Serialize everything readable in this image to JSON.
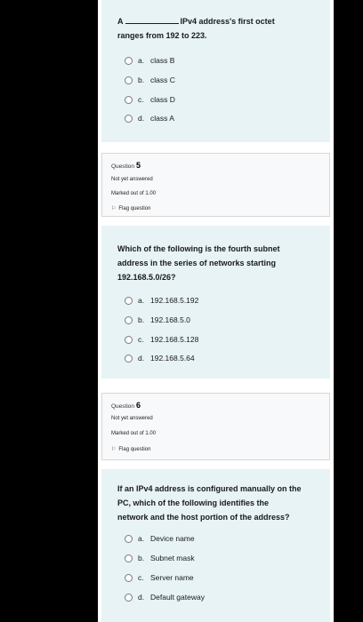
{
  "q4": {
    "prefix": "A",
    "suffix": "IPv4 address's first octet",
    "line2": "ranges from 192 to 223.",
    "options": [
      {
        "letter": "a.",
        "text": "class B"
      },
      {
        "letter": "b.",
        "text": "class C"
      },
      {
        "letter": "c.",
        "text": "class D"
      },
      {
        "letter": "d.",
        "text": "class A"
      }
    ]
  },
  "q5_info": {
    "label": "Question",
    "number": "5",
    "status": "Not yet answered",
    "marks": "Marked out of 1.00",
    "flag": "Flag question"
  },
  "q5": {
    "lines": [
      "Which of the following is the fourth subnet",
      "address in the series of networks starting",
      "192.168.5.0/26?"
    ],
    "options": [
      {
        "letter": "a.",
        "text": "192.168.5.192"
      },
      {
        "letter": "b.",
        "text": "192.168.5.0"
      },
      {
        "letter": "c.",
        "text": "192.168.5.128"
      },
      {
        "letter": "d.",
        "text": "192.168.5.64"
      }
    ]
  },
  "q6_info": {
    "label": "Question",
    "number": "6",
    "status": "Not yet answered",
    "marks": "Marked out of 1.00",
    "flag": "Flag question"
  },
  "q6": {
    "lines": [
      "If an IPv4 address is configured manually on the",
      "PC, which of the following identifies the",
      "network and the host portion of the address?"
    ],
    "options": [
      {
        "letter": "a.",
        "text": "Device name"
      },
      {
        "letter": "b.",
        "text": "Subnet mask"
      },
      {
        "letter": "c.",
        "text": "Server name"
      },
      {
        "letter": "d.",
        "text": "Default gateway"
      }
    ]
  }
}
